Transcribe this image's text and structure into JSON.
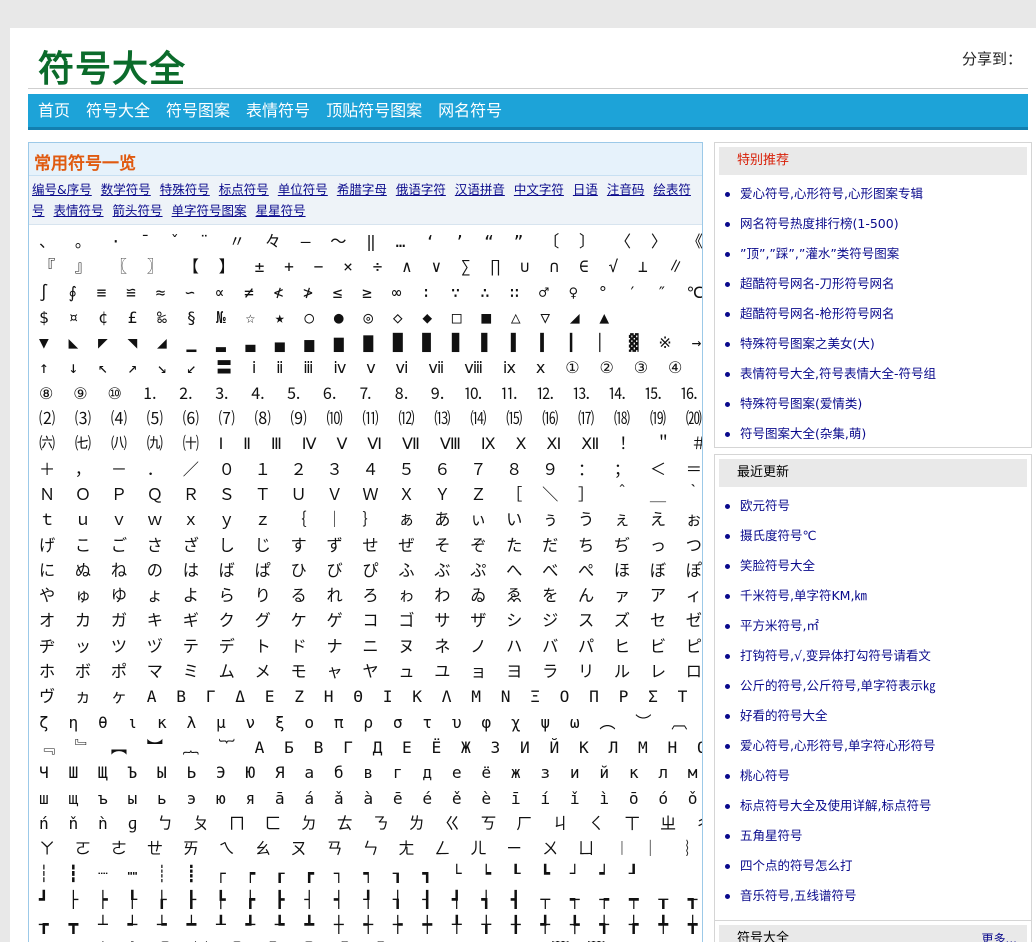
{
  "header": {
    "logo": "符号大全",
    "share": "分享到："
  },
  "nav": [
    "首页",
    "符号大全",
    "符号图案",
    "表情符号",
    "顶贴符号图案",
    "网名符号"
  ],
  "main": {
    "title": "常用符号一览",
    "categories": [
      "编号&序号",
      "数学符号",
      "特殊符号",
      "标点符号",
      "单位符号",
      "希腊字母",
      "俄语字符",
      "汉语拼音",
      "中文字符",
      "日语",
      "注音码",
      "绘表符号",
      "表情符号",
      "箭头符号",
      "单字符号图案",
      "星星符号"
    ],
    "symbol_rows": [
      "、 。 · ˉ ˇ ¨ 〃 々 — ～ ‖ … ‘ ’ “ ” 〔 〕 〈 〉 《 》 「 」",
      "『 』 〖 〗 【 】 ± + − × ÷ ∧ ∨ ∑ ∏ ∪ ∩ ∈ √ ⊥ ∥ ∠ ⌒ ⊙",
      "∫ ∮ ≡ ≌ ≈ ∽ ∝ ≠ ≮ ≯ ≤ ≥ ∞ ∶ ∵ ∴ ∷ ♂ ♀ ° ′ ″ ℃",
      "$ ¤ ¢ £ ‰ § № ☆ ★ ○ ● ◎ ◇ ◆ □ ■ △ ▽ ◢ ▲",
      "▼ ◣ ◤ ◥ ◢ ▁ ▂ ▃ ▄ ▅ ▆ ▇ █ ▉ ▊ ▋ ▌ ▍ ▎ ▏ ▓ ※ → ←",
      "↑ ↓ ↖ ↗ ↘ ↙ 〓 ⅰ ⅱ ⅲ ⅳ ⅴ ⅵ ⅶ ⅷ ⅸ ⅹ ① ② ③ ④ ⑤ ⑥ ⑦",
      "⑧ ⑨ ⑩ ⒈ ⒉ ⒊ ⒋ ⒌ ⒍ ⒎ ⒏ ⒐ ⒑ ⒒ ⒓ ⒔ ⒕ ⒖ ⒗ ⒘ ⒙ ⒚ ⒛ ⑴",
      "⑵ ⑶ ⑷ ⑸ ⑹ ⑺ ⑻ ⑼ ⑽ ⑾ ⑿ ⒀ ⒁ ⒂ ⒃ ⒄ ⒅ ⒆ ⒇ ㈠ ㈡ ㈢ ㈣ ㈤",
      "㈥ ㈦ ㈧ ㈨ ㈩ Ⅰ Ⅱ Ⅲ Ⅳ Ⅴ Ⅵ Ⅶ Ⅷ Ⅸ Ⅹ Ⅺ Ⅻ ！ ＂ ＃ ￥ ％ ＆ ＇ （ ） ＊",
      "＋ ， － ． ／ ０ １ ２ ３ ４ ５ ６ ７ ８ ９ ： ； ＜ ＝ ＞ ？ ＠ Ａ Ｂ Ｃ Ｄ Ｅ Ｆ Ｇ Ｈ Ｉ Ｊ Ｋ Ｌ Ｍ",
      "Ｎ Ｏ Ｐ Ｑ Ｒ Ｓ Ｔ Ｕ Ｖ Ｗ Ｘ Ｙ Ｚ ［ ＼ ］ ＾ ＿ ｀ ａ ｂ ｃ ｄ ｅ ｆ ｇ ｈ ｉ ｊ ｋ ｌ ｍ ｎ ｏ ｐ ｑ ｒ ｓ",
      "ｔ ｕ ｖ ｗ ｘ ｙ ｚ ｛ ｜ ｝ ぁ あ ぃ い ぅ う ぇ え ぉ お か が き ぎ く ぐ け",
      "げ こ ご さ ざ し じ す ず せ ぜ そ ぞ た だ ち ぢ っ つ づ て で と ど な",
      "に ぬ ね の は ば ぱ ひ び ぴ ふ ぶ ぷ へ べ ぺ ほ ぼ ぽ ま み む め も ゃ",
      "や ゅ ゆ ょ よ ら り る れ ろ ゎ わ ゐ ゑ を ん ァ ア ィ イ ゥ ウ ェ エ ォ",
      "オ カ ガ キ ギ ク グ ケ ゲ コ ゴ サ ザ シ ジ ス ズ セ ゼ ソ ゾ タ ダ チ",
      "ヂ ッ ツ ヅ テ デ ト ド ナ ニ ヌ ネ ノ ハ バ パ ヒ ビ ピ フ ブ プ ヘ ベ ペ",
      "ホ ボ ポ マ ミ ム メ モ ャ ヤ ュ ユ ョ ヨ ラ リ ル レ ロ ヮ ワ ヰ ヱ ヲ ン",
      "ヴ ヵ ヶ Α Β Γ Δ Ε Ζ Η Θ Ι Κ Λ Μ Ν Ξ Ο Π Ρ Σ Τ Υ Φ Χ Ψ Ω α β γ δ ε",
      "ζ η θ ι κ λ μ ν ξ ο π ρ σ τ υ φ χ ψ ω ︵ ︶ ︹ ︺ ︿ ﹀ ︽ ︾ ﹁ ﹂",
      "﹃ ﹄ ︻ ︼ ︷ ︸ А Б В Г Д Е Ё Ж З И Й К Л М Н О П Р С Т У Ф Х Ц",
      "Ч Ш Щ Ъ Ы Ь Э Ю Я а б в г д е ё ж з и й к л м н о п р с т у ф х ц ч",
      "ш щ ъ ы ь э ю я ā á ǎ à ē é ě è ī í ǐ ì ō ó ǒ ò ū ú ǔ ù ǖ ǘ ǚ ǜ ü ê ɑ ḿ",
      "ń ň ǹ ɡ ㄅ ㄆ ㄇ ㄈ ㄉ ㄊ ㄋ ㄌ ㄍ ㄎ ㄏ ㄐ ㄑ ㄒ ㄓ ㄔ ㄕ ㄖ ㄗ ㄘ ㄙ",
      "ㄚ ㄛ ㄜ ㄝ ㄞ ㄟ ㄠ ㄡ ㄢ ㄣ ㄤ ㄥ ㄦ ㄧ ㄨ ㄩ ︱ ︳ ︴ ﹏ ─ ━ │ ┃",
      "┆ ┇ ┈ ┉ ┊ ┋ ┌ ┍ ┎ ┏ ┐ ┑ ┒ ┓ └ ┕ ┖ ┗ ┘ ┙ ┚",
      "┛ ├ ┝ ┞ ┟ ┠ ┡ ┢ ┣ ┤ ┥ ┦ ┧ ┨ ┩ ┪ ┫ ┬ ┭ ┮ ┯ ┰ ┱",
      "┲ ┳ ┴ ┵ ┶ ┷ ┸ ┹ ┺ ┻ ┼ ┽ ┾ ┿ ╀ ╁ ╂ ╃ ╄ ╅ ╆ ╇ ╈ ╉ ╊ ╋",
      "╌ ╍ ╎ ╏ ㊣ ㈱ ㊞ ㊥ ㊕ ㊐ ㊑ ﹉ ﹊ ﹍ ﹎ ﹋ ﹌ ﹟ ﹠"
    ]
  },
  "sidebar": {
    "recommend": {
      "title": "特别推荐",
      "items": [
        "爱心符号,心形符号,心形图案专辑",
        "网名符号热度排行榜(1-500)",
        "”顶”,”踩”,”灌水”类符号图案",
        "超酷符号网名-刀形符号网名",
        "超酷符号网名-枪形符号网名",
        "特殊符号图案之美女(大)",
        "表情符号大全,符号表情大全-符号组",
        "特殊符号图案(爱情类)",
        "符号图案大全(杂集,萌)"
      ]
    },
    "recent": {
      "title": "最近更新",
      "items": [
        "欧元符号",
        "摄氏度符号℃",
        "笑脸符号大全",
        "千米符号,单字符KM,㎞",
        "平方米符号,㎡",
        "打钩符号,√,变异体打勾符号请看文",
        "公斤的符号,公斤符号,单字符表示㎏",
        "好看的符号大全",
        "爱心符号,心形符号,单字符心形符号",
        "桃心符号",
        "标点符号大全及使用详解,标点符号",
        "五角星符号",
        "四个点的符号怎么打",
        "音乐符号,五线谱符号"
      ]
    },
    "third": {
      "title": "符号大全",
      "more": "更多..."
    }
  }
}
